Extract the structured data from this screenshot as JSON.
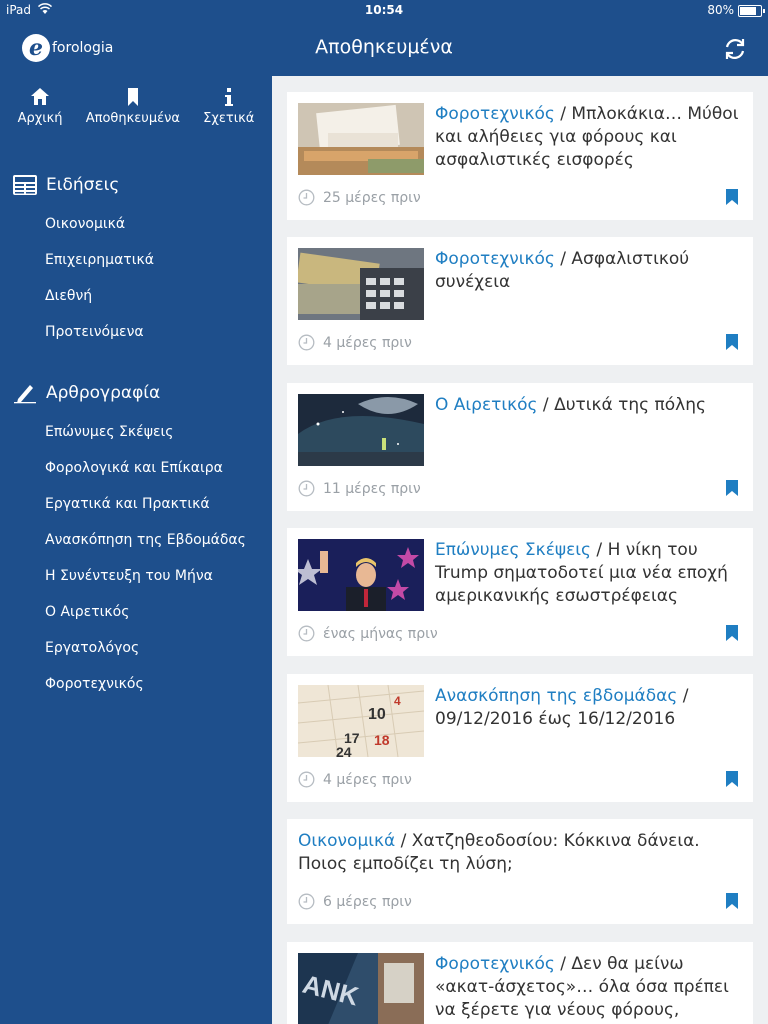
{
  "status": {
    "carrier": "iPad",
    "time": "10:54",
    "battery": "80%",
    "battery_level": 0.8
  },
  "navbar": {
    "logo_letter": "e",
    "logo_text": "forologia",
    "title": "Αποθηκευμένα"
  },
  "sidebar": {
    "tabs": [
      {
        "label": "Αρχική",
        "icon": "home-icon"
      },
      {
        "label": "Αποθηκευμένα",
        "icon": "bookmark-icon"
      },
      {
        "label": "Σχετικά",
        "icon": "info-icon"
      }
    ],
    "news": {
      "title": "Ειδήσεις",
      "items": [
        "Οικονομικά",
        "Επιχειρηματικά",
        "Διεθνή",
        "Προτεινόμενα"
      ]
    },
    "articles": {
      "title": "Αρθρογραφία",
      "items": [
        "Επώνυμες Σκέψεις",
        "Φορολογικά και Επίκαιρα",
        "Εργατικά και Πρακτικά",
        "Ανασκόπηση της Εβδομάδας",
        "Η Συνέντευξη του Μήνα",
        "Ο Αιρετικός",
        "Εργατολόγος",
        "Φοροτεχνικός"
      ]
    }
  },
  "cards": [
    {
      "category": "Φοροτεχνικός",
      "title": "Μπλοκάκια… Μύθοι και αλήθειες για φόρους και ασφαλιστικές εισφορές",
      "time": "25 μέρες πριν"
    },
    {
      "category": "Φοροτεχνικός",
      "title": "Ασφαλιστικού συνέχεια",
      "time": "4 μέρες πριν"
    },
    {
      "category": "Ο Αιρετικός",
      "title": "Δυτικά της πόλης",
      "time": "11 μέρες πριν"
    },
    {
      "category": "Επώνυμες Σκέψεις",
      "title": "Η νίκη του Trump σηματοδοτεί μια νέα εποχή αμερικανικής εσωστρέφειας",
      "time": "ένας μήνας πριν"
    },
    {
      "category": "Ανασκόπηση της εβδομάδας",
      "title": "09/12/2016 έως 16/12/2016",
      "time": "4 μέρες πριν"
    },
    {
      "category": "Οικονομικά",
      "title": "Χατζηθεοδοσίου: Κόκκινα δάνεια. Ποιος εμποδίζει τη λύση;",
      "time": "6 μέρες πριν"
    },
    {
      "category": "Φοροτεχνικός",
      "title": "Δεν θα μείνω «ακατ-άσχετος»… όλα όσα πρέπει να ξέρετε για νέους φόρους, προσαυξήσεις και",
      "time": ""
    }
  ],
  "colors": {
    "brand": "#1e4f8c",
    "link": "#1f7ec2",
    "content_bg": "#eef0f2"
  }
}
